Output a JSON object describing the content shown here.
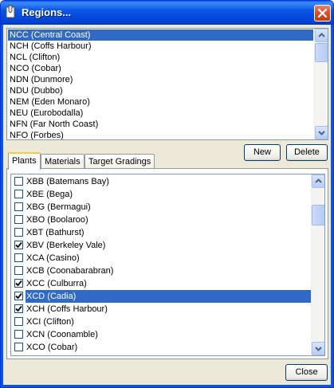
{
  "window": {
    "title": "Regions..."
  },
  "regions": {
    "items": [
      "NCC (Central Coast)",
      "NCH (Coffs Harbour)",
      "NCL (Clifton)",
      "NCO (Cobar)",
      "NDN (Dunmore)",
      "NDU (Dubbo)",
      "NEM (Eden Monaro)",
      "NEU (Eurobodalla)",
      "NFN (Far North Coast)",
      "NFO (Forbes)"
    ],
    "selected_index": 0
  },
  "buttons": {
    "new_label": "New",
    "delete_label": "Delete",
    "close_label": "Close"
  },
  "tabs": [
    {
      "label": "Plants",
      "active": true
    },
    {
      "label": "Materials",
      "active": false
    },
    {
      "label": "Target Gradings",
      "active": false
    }
  ],
  "plants": [
    {
      "label": "XBB (Batemans Bay)",
      "checked": false,
      "selected": false
    },
    {
      "label": "XBE (Bega)",
      "checked": false,
      "selected": false
    },
    {
      "label": "XBG (Bermagui)",
      "checked": false,
      "selected": false
    },
    {
      "label": "XBO (Boolaroo)",
      "checked": false,
      "selected": false
    },
    {
      "label": "XBT (Bathurst)",
      "checked": false,
      "selected": false
    },
    {
      "label": "XBV (Berkeley Vale)",
      "checked": true,
      "selected": false
    },
    {
      "label": "XCA (Casino)",
      "checked": false,
      "selected": false
    },
    {
      "label": "XCB (Coonabarabran)",
      "checked": false,
      "selected": false
    },
    {
      "label": "XCC (Culburra)",
      "checked": true,
      "selected": false
    },
    {
      "label": "XCD (Cadia)",
      "checked": true,
      "selected": true
    },
    {
      "label": "XCH (Coffs Harbour)",
      "checked": true,
      "selected": false
    },
    {
      "label": "XCI (Clifton)",
      "checked": false,
      "selected": false
    },
    {
      "label": "XCN (Coonamble)",
      "checked": false,
      "selected": false
    },
    {
      "label": "XCO (Cobar)",
      "checked": false,
      "selected": false
    }
  ],
  "icons": {
    "app": "document-pencil-icon",
    "close": "close-icon",
    "scroll_up": "chevron-up-icon",
    "scroll_down": "chevron-down-icon",
    "check": "checkmark-icon"
  },
  "colors": {
    "selection": "#316ac5",
    "titlebar": "#0b55e5",
    "close": "#d9532c"
  }
}
